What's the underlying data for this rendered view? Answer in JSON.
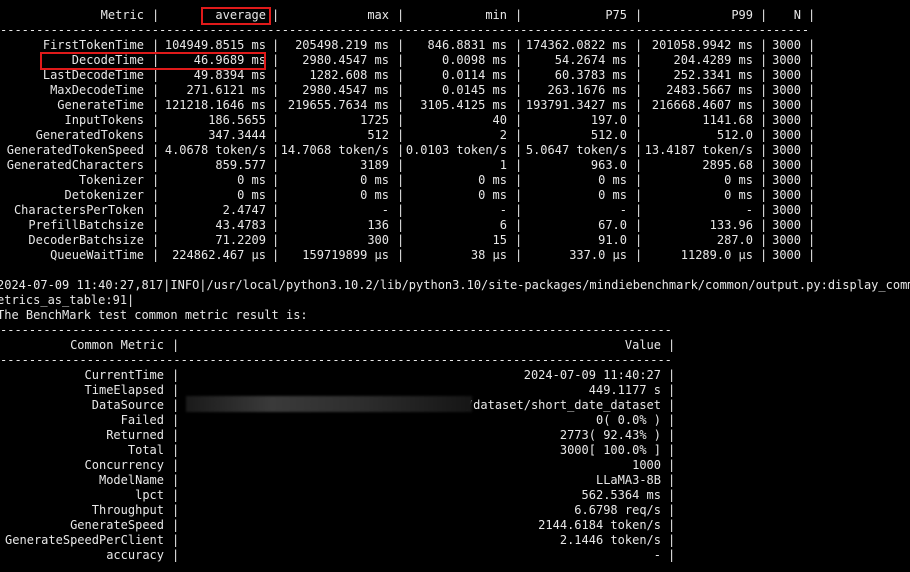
{
  "table1": {
    "headers": [
      "Metric",
      "average",
      "max",
      "min",
      "P75",
      "P99",
      "N"
    ],
    "rows": [
      [
        "FirstTokenTime",
        "104949.8515 ms",
        "205498.219 ms",
        "846.8831 ms",
        "174362.0822 ms",
        "201058.9942 ms",
        "3000"
      ],
      [
        "DecodeTime",
        "46.9689 ms",
        "2980.4547 ms",
        "0.0098 ms",
        "54.2674 ms",
        "204.4289 ms",
        "3000"
      ],
      [
        "LastDecodeTime",
        "49.8394 ms",
        "1282.608 ms",
        "0.0114 ms",
        "60.3783 ms",
        "252.3341 ms",
        "3000"
      ],
      [
        "MaxDecodeTime",
        "271.6121 ms",
        "2980.4547 ms",
        "0.0145 ms",
        "263.1676 ms",
        "2483.5667 ms",
        "3000"
      ],
      [
        "GenerateTime",
        "121218.1646 ms",
        "219655.7634 ms",
        "3105.4125 ms",
        "193791.3427 ms",
        "216668.4607 ms",
        "3000"
      ],
      [
        "InputTokens",
        "186.5655",
        "1725",
        "40",
        "197.0",
        "1141.68",
        "3000"
      ],
      [
        "GeneratedTokens",
        "347.3444",
        "512",
        "2",
        "512.0",
        "512.0",
        "3000"
      ],
      [
        "GeneratedTokenSpeed",
        "4.0678 token/s",
        "14.7068 token/s",
        "0.0103 token/s",
        "5.0647 token/s",
        "13.4187 token/s",
        "3000"
      ],
      [
        "GeneratedCharacters",
        "859.577",
        "3189",
        "1",
        "963.0",
        "2895.68",
        "3000"
      ],
      [
        "Tokenizer",
        "0 ms",
        "0 ms",
        "0 ms",
        "0 ms",
        "0 ms",
        "3000"
      ],
      [
        "Detokenizer",
        "0 ms",
        "0 ms",
        "0 ms",
        "0 ms",
        "0 ms",
        "3000"
      ],
      [
        "CharactersPerToken",
        "2.4747",
        "-",
        "-",
        "-",
        "-",
        "3000"
      ],
      [
        "PrefillBatchsize",
        "43.4783",
        "136",
        "6",
        "67.0",
        "133.96",
        "3000"
      ],
      [
        "DecoderBatchsize",
        "71.2209",
        "300",
        "15",
        "91.0",
        "287.0",
        "3000"
      ],
      [
        "QueueWaitTime",
        "224862.467 μs",
        "159719899 μs",
        "38 μs",
        "337.0 μs",
        "11289.0 μs",
        "3000"
      ]
    ]
  },
  "log": {
    "line1": "2024-07-09 11:40:27,817|INFO|/usr/local/python3.10.2/lib/python3.10/site-packages/mindiebenchmark/common/output.py:display_common_m",
    "line2": "etrics_as_table:91|",
    "line3": "The BenchMark test common metric result is:"
  },
  "table2": {
    "headers": [
      "Common Metric",
      "Value"
    ],
    "rows": [
      [
        "CurrentTime",
        "2024-07-09 11:40:27"
      ],
      [
        "TimeElapsed",
        "449.1177 s"
      ],
      [
        "DataSource",
        "/dataset/short_date_dataset"
      ],
      [
        "Failed",
        "0( 0.0% )"
      ],
      [
        "Returned",
        "2773( 92.43% )"
      ],
      [
        "Total",
        "3000[ 100.0% ]"
      ],
      [
        "Concurrency",
        "1000"
      ],
      [
        "ModelName",
        "LLaMA3-8B"
      ],
      [
        "lpct",
        "562.5364 ms"
      ],
      [
        "Throughput",
        "6.6798 req/s"
      ],
      [
        "GenerateSpeed",
        "2144.6184 token/s"
      ],
      [
        "GenerateSpeedPerClient",
        "2.1446 token/s"
      ],
      [
        "accuracy",
        "-"
      ]
    ]
  },
  "colors": {
    "background": "#000000",
    "text": "#e8e8e8",
    "highlight": "#e01a1a"
  }
}
